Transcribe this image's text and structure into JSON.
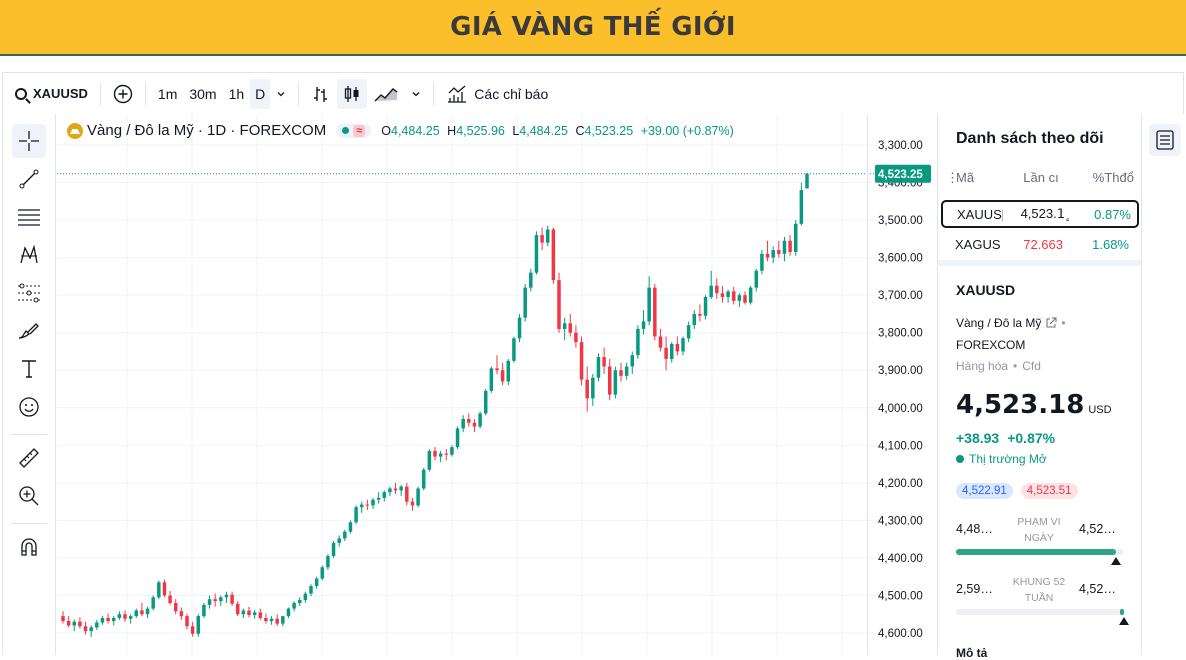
{
  "banner": {
    "title": "GIÁ VÀNG THẾ GIỚI"
  },
  "toolbar": {
    "symbol": "XAUUSD",
    "intervals": [
      "1m",
      "30m",
      "1h",
      "D"
    ],
    "indicators_label": "Các chỉ báo"
  },
  "legend": {
    "title": "Vàng / Đô la Mỹ · 1D · FOREXCOM",
    "open_label": "O",
    "open": "4,484.25",
    "high_label": "H",
    "high": "4,525.96",
    "low_label": "L",
    "low": "4,484.25",
    "close_label": "C",
    "close": "4,523.25",
    "change": "+39.00 (+0.87%)"
  },
  "price_axis": {
    "ticks": [
      "4,600.00",
      "4,500.00",
      "4,400.00",
      "4,300.00",
      "4,200.00",
      "4,100.00",
      "4,000.00",
      "3,900.00",
      "3,800.00",
      "3,700.00",
      "3,600.00",
      "3,500.00",
      "3,400.00",
      "3,300.00"
    ],
    "last_price_label": "4,523.25"
  },
  "watchlist": {
    "title": "Danh sách theo dõi",
    "columns": [
      "Mã",
      "Lần cı",
      "%Thđổ"
    ],
    "rows": [
      {
        "symbol": "XAUUS[",
        "last": "4,523.1ٍ",
        "change": "0.87%"
      },
      {
        "symbol": "XAGUS[",
        "last": "72.663",
        "change": "1.68%"
      }
    ]
  },
  "details": {
    "symbol": "XAUUSD",
    "description": "Vàng / Đô la Mỹ",
    "exchange": "FOREXCOM",
    "category": "Hàng hóa",
    "type": "Cfd",
    "price": "4,523.18",
    "currency": "USD",
    "change": "+38.93",
    "change_pct": "+0.87%",
    "market_status": "Thị trường Mở",
    "bid": "4,522.91",
    "ask": "4,523.51",
    "day_range_label": "PHẠM VI NGÀY",
    "day_low": "4,48…",
    "day_high": "4,52…",
    "day_range_fraction": 0.95,
    "week52_label": "KHUNG 52 TUẦN",
    "week52_low": "2,59…",
    "week52_high": "4,52…",
    "week52_fraction": 1.0,
    "footer_partial": "Mô tả"
  },
  "colors": {
    "up": "#089981",
    "down": "#f23645",
    "banner": "#fbbf2c"
  },
  "chart_data": {
    "type": "candlestick",
    "title": "Vàng / Đô la Mỹ · 1D · FOREXCOM",
    "ylim": [
      3280,
      4630
    ],
    "y_ticks": [
      3300,
      3400,
      3500,
      3600,
      3700,
      3800,
      3900,
      4000,
      4100,
      4200,
      4300,
      4400,
      4500,
      4600
    ],
    "grid": true,
    "last_price": 4523.25,
    "candles": [
      [
        3345,
        3358,
        3325,
        3332
      ],
      [
        3332,
        3345,
        3315,
        3320
      ],
      [
        3320,
        3336,
        3305,
        3330
      ],
      [
        3330,
        3342,
        3312,
        3318
      ],
      [
        3318,
        3330,
        3296,
        3305
      ],
      [
        3305,
        3320,
        3290,
        3315
      ],
      [
        3315,
        3335,
        3308,
        3328
      ],
      [
        3328,
        3346,
        3322,
        3340
      ],
      [
        3340,
        3352,
        3325,
        3332
      ],
      [
        3332,
        3345,
        3320,
        3340
      ],
      [
        3340,
        3358,
        3335,
        3350
      ],
      [
        3350,
        3360,
        3330,
        3338
      ],
      [
        3338,
        3350,
        3325,
        3345
      ],
      [
        3345,
        3365,
        3340,
        3360
      ],
      [
        3360,
        3380,
        3345,
        3350
      ],
      [
        3350,
        3370,
        3340,
        3365
      ],
      [
        3365,
        3400,
        3360,
        3395
      ],
      [
        3395,
        3440,
        3390,
        3435
      ],
      [
        3435,
        3442,
        3395,
        3400
      ],
      [
        3400,
        3412,
        3375,
        3380
      ],
      [
        3380,
        3390,
        3350,
        3358
      ],
      [
        3358,
        3368,
        3335,
        3345
      ],
      [
        3345,
        3352,
        3310,
        3318
      ],
      [
        3318,
        3330,
        3290,
        3298
      ],
      [
        3298,
        3350,
        3290,
        3345
      ],
      [
        3345,
        3380,
        3340,
        3375
      ],
      [
        3375,
        3400,
        3365,
        3390
      ],
      [
        3390,
        3405,
        3370,
        3385
      ],
      [
        3385,
        3400,
        3372,
        3395
      ],
      [
        3395,
        3410,
        3380,
        3402
      ],
      [
        3402,
        3410,
        3372,
        3378
      ],
      [
        3378,
        3385,
        3345,
        3350
      ],
      [
        3350,
        3365,
        3340,
        3360
      ],
      [
        3360,
        3370,
        3342,
        3348
      ],
      [
        3348,
        3362,
        3338,
        3355
      ],
      [
        3355,
        3365,
        3335,
        3340
      ],
      [
        3340,
        3352,
        3325,
        3332
      ],
      [
        3332,
        3345,
        3322,
        3338
      ],
      [
        3338,
        3350,
        3318,
        3325
      ],
      [
        3325,
        3340,
        3318,
        3345
      ],
      [
        3345,
        3368,
        3340,
        3365
      ],
      [
        3365,
        3385,
        3358,
        3380
      ],
      [
        3380,
        3395,
        3372,
        3388
      ],
      [
        3388,
        3410,
        3380,
        3405
      ],
      [
        3405,
        3430,
        3398,
        3425
      ],
      [
        3425,
        3450,
        3418,
        3445
      ],
      [
        3445,
        3480,
        3440,
        3475
      ],
      [
        3475,
        3510,
        3468,
        3505
      ],
      [
        3505,
        3545,
        3500,
        3540
      ],
      [
        3540,
        3560,
        3530,
        3552
      ],
      [
        3552,
        3575,
        3545,
        3570
      ],
      [
        3570,
        3600,
        3565,
        3595
      ],
      [
        3595,
        3640,
        3590,
        3635
      ],
      [
        3635,
        3650,
        3620,
        3642
      ],
      [
        3642,
        3655,
        3628,
        3640
      ],
      [
        3640,
        3660,
        3630,
        3655
      ],
      [
        3655,
        3675,
        3645,
        3660
      ],
      [
        3660,
        3680,
        3650,
        3675
      ],
      [
        3675,
        3690,
        3665,
        3685
      ],
      [
        3685,
        3700,
        3670,
        3680
      ],
      [
        3680,
        3695,
        3665,
        3690
      ],
      [
        3690,
        3700,
        3640,
        3650
      ],
      [
        3650,
        3660,
        3625,
        3640
      ],
      [
        3640,
        3690,
        3635,
        3685
      ],
      [
        3685,
        3740,
        3680,
        3735
      ],
      [
        3735,
        3790,
        3730,
        3785
      ],
      [
        3785,
        3795,
        3760,
        3770
      ],
      [
        3770,
        3785,
        3755,
        3778
      ],
      [
        3778,
        3790,
        3760,
        3775
      ],
      [
        3775,
        3800,
        3770,
        3795
      ],
      [
        3795,
        3850,
        3790,
        3845
      ],
      [
        3845,
        3880,
        3835,
        3870
      ],
      [
        3870,
        3885,
        3850,
        3860
      ],
      [
        3860,
        3870,
        3835,
        3850
      ],
      [
        3850,
        3890,
        3845,
        3885
      ],
      [
        3885,
        3950,
        3880,
        3945
      ],
      [
        3945,
        4010,
        3940,
        4005
      ],
      [
        4005,
        4040,
        3990,
        4000
      ],
      [
        4000,
        4020,
        3960,
        3970
      ],
      [
        3970,
        4030,
        3960,
        4025
      ],
      [
        4025,
        4090,
        4020,
        4085
      ],
      [
        4085,
        4150,
        4075,
        4140
      ],
      [
        4140,
        4230,
        4130,
        4220
      ],
      [
        4220,
        4270,
        4210,
        4260
      ],
      [
        4260,
        4370,
        4255,
        4360
      ],
      [
        4360,
        4380,
        4320,
        4340
      ],
      [
        4340,
        4385,
        4330,
        4375
      ],
      [
        4375,
        4380,
        4230,
        4240
      ],
      [
        4240,
        4260,
        4100,
        4110
      ],
      [
        4110,
        4140,
        4080,
        4125
      ],
      [
        4125,
        4150,
        4090,
        4100
      ],
      [
        4100,
        4120,
        4060,
        4075
      ],
      [
        4075,
        4090,
        3960,
        3975
      ],
      [
        3975,
        4010,
        3890,
        3925
      ],
      [
        3925,
        3990,
        3905,
        3980
      ],
      [
        3980,
        4045,
        3970,
        4035
      ],
      [
        4035,
        4060,
        3990,
        4010
      ],
      [
        4010,
        4030,
        3920,
        3935
      ],
      [
        3935,
        4010,
        3925,
        4000
      ],
      [
        4000,
        4020,
        3970,
        3985
      ],
      [
        3985,
        4020,
        3975,
        4010
      ],
      [
        4010,
        4050,
        3990,
        4040
      ],
      [
        4040,
        4120,
        4030,
        4110
      ],
      [
        4110,
        4160,
        4095,
        4130
      ],
      [
        4130,
        4250,
        4120,
        4220
      ],
      [
        4220,
        4230,
        4080,
        4090
      ],
      [
        4090,
        4110,
        4050,
        4060
      ],
      [
        4060,
        4090,
        4000,
        4030
      ],
      [
        4030,
        4075,
        4020,
        4070
      ],
      [
        4070,
        4090,
        4040,
        4050
      ],
      [
        4050,
        4090,
        4040,
        4085
      ],
      [
        4085,
        4130,
        4075,
        4120
      ],
      [
        4120,
        4160,
        4110,
        4150
      ],
      [
        4150,
        4175,
        4130,
        4145
      ],
      [
        4145,
        4200,
        4135,
        4195
      ],
      [
        4195,
        4265,
        4190,
        4225
      ],
      [
        4225,
        4245,
        4190,
        4205
      ],
      [
        4205,
        4225,
        4180,
        4195
      ],
      [
        4195,
        4215,
        4180,
        4210
      ],
      [
        4210,
        4222,
        4175,
        4185
      ],
      [
        4185,
        4205,
        4168,
        4200
      ],
      [
        4200,
        4210,
        4175,
        4180
      ],
      [
        4180,
        4225,
        4175,
        4220
      ],
      [
        4220,
        4270,
        4210,
        4265
      ],
      [
        4265,
        4320,
        4255,
        4310
      ],
      [
        4310,
        4345,
        4290,
        4300
      ],
      [
        4300,
        4330,
        4285,
        4320
      ],
      [
        4320,
        4345,
        4300,
        4310
      ],
      [
        4310,
        4355,
        4290,
        4345
      ],
      [
        4345,
        4360,
        4305,
        4315
      ],
      [
        4315,
        4400,
        4305,
        4390
      ],
      [
        4390,
        4500,
        4385,
        4480
      ],
      [
        4484.25,
        4525.96,
        4484.25,
        4523.25
      ]
    ]
  }
}
